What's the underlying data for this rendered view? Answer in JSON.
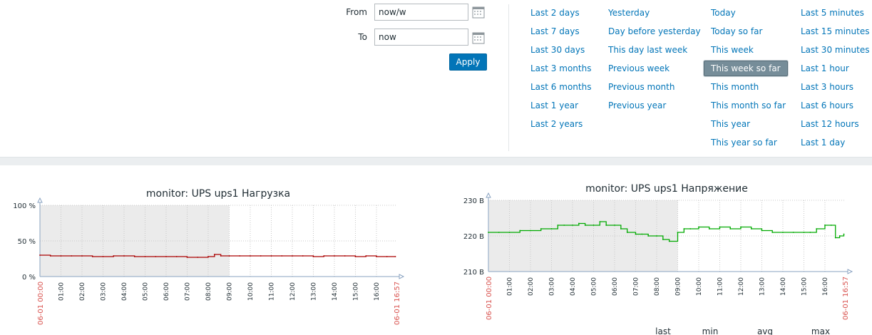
{
  "filter": {
    "from_label": "From",
    "from_value": "now/w",
    "to_label": "To",
    "to_value": "now",
    "apply_label": "Apply",
    "quick_columns": [
      [
        "Last 2 days",
        "Last 7 days",
        "Last 30 days",
        "Last 3 months",
        "Last 6 months",
        "Last 1 year",
        "Last 2 years"
      ],
      [
        "Yesterday",
        "Day before yesterday",
        "This day last week",
        "Previous week",
        "Previous month",
        "Previous year"
      ],
      [
        "Today",
        "Today so far",
        "This week",
        "This week so far",
        "This month",
        "This month so far",
        "This year",
        "This year so far"
      ],
      [
        "Last 5 minutes",
        "Last 15 minutes",
        "Last 30 minutes",
        "Last 1 hour",
        "Last 3 hours",
        "Last 6 hours",
        "Last 12 hours",
        "Last 1 day"
      ]
    ],
    "selected": "This week so far",
    "colors": {
      "link": "#0275b8",
      "selected_bg": "#768d99",
      "apply_bg": "#0275b8"
    }
  },
  "chart_data": [
    {
      "type": "line",
      "title": "monitor: UPS ups1 Нагрузка",
      "ylim": [
        0,
        100
      ],
      "y_tick_labels": [
        "100 %",
        "50 %",
        "0 %"
      ],
      "y_ticks": [
        100,
        50,
        0
      ],
      "x_tick_labels": [
        "01:00",
        "02:00",
        "03:00",
        "04:00",
        "05:00",
        "06:00",
        "07:00",
        "08:00",
        "09:00",
        "10:00",
        "11:00",
        "12:00",
        "13:00",
        "14:00",
        "15:00",
        "16:00"
      ],
      "x_start_label": "06-01 00:00",
      "x_end_label": "06-01 16:57",
      "xlim": [
        0,
        16.95
      ],
      "shaded_until": 9,
      "series": [
        {
          "color": "#aa0000",
          "x": [
            0,
            0.5,
            1,
            1.5,
            2,
            2.5,
            3,
            3.5,
            4,
            4.5,
            5,
            5.5,
            6,
            6.5,
            7,
            7.5,
            8,
            8.3,
            8.6,
            9,
            9.5,
            10,
            10.5,
            11,
            11.5,
            12,
            12.5,
            13,
            13.5,
            14,
            14.5,
            15,
            15.5,
            16,
            16.5,
            16.9
          ],
          "y": [
            30,
            29,
            29,
            29,
            29,
            28,
            28,
            29,
            29,
            28,
            28,
            28,
            28,
            28,
            27,
            27,
            28,
            31,
            29,
            29,
            29,
            29,
            29,
            29,
            29,
            29,
            29,
            28,
            29,
            29,
            29,
            28,
            29,
            28,
            28,
            28
          ]
        }
      ],
      "legend_hint": "..."
    },
    {
      "type": "line",
      "title": "monitor: UPS ups1 Напряжение",
      "ylim": [
        210,
        230
      ],
      "y_tick_labels": [
        "230 В",
        "220 В",
        "210 В"
      ],
      "y_ticks": [
        230,
        220,
        210
      ],
      "x_tick_labels": [
        "01:00",
        "02:00",
        "03:00",
        "04:00",
        "05:00",
        "06:00",
        "07:00",
        "08:00",
        "09:00",
        "10:00",
        "11:00",
        "12:00",
        "13:00",
        "14:00",
        "15:00",
        "16:00"
      ],
      "x_start_label": "06-01 00:00",
      "x_end_label": "06-01 16:57",
      "xlim": [
        0,
        16.95
      ],
      "shaded_until": 9,
      "series": [
        {
          "color": "#00aa00",
          "x": [
            0,
            0.5,
            1,
            1.5,
            2,
            2.5,
            3,
            3.3,
            3.6,
            4,
            4.3,
            4.6,
            5,
            5.3,
            5.6,
            6,
            6.3,
            6.6,
            7,
            7.3,
            7.6,
            8,
            8.3,
            8.6,
            9,
            9.3,
            9.6,
            10,
            10.5,
            11,
            11.5,
            12,
            12.5,
            13,
            13.5,
            14,
            14.5,
            15,
            15.3,
            15.6,
            16,
            16.3,
            16.5,
            16.7,
            16.9
          ],
          "y": [
            221,
            221,
            221,
            221.5,
            221.5,
            222,
            222,
            223,
            223,
            223,
            223.5,
            223,
            223,
            224,
            223,
            223,
            222,
            221,
            220.5,
            220.5,
            220,
            220,
            219,
            218.5,
            221,
            222,
            222,
            222.5,
            222,
            222.5,
            222,
            222.5,
            222,
            221.5,
            221,
            221,
            221,
            221,
            221,
            222,
            223,
            223,
            219.5,
            220,
            220.5
          ]
        }
      ],
      "legend_labels": [
        "last",
        "min",
        "avg",
        "max"
      ]
    }
  ]
}
